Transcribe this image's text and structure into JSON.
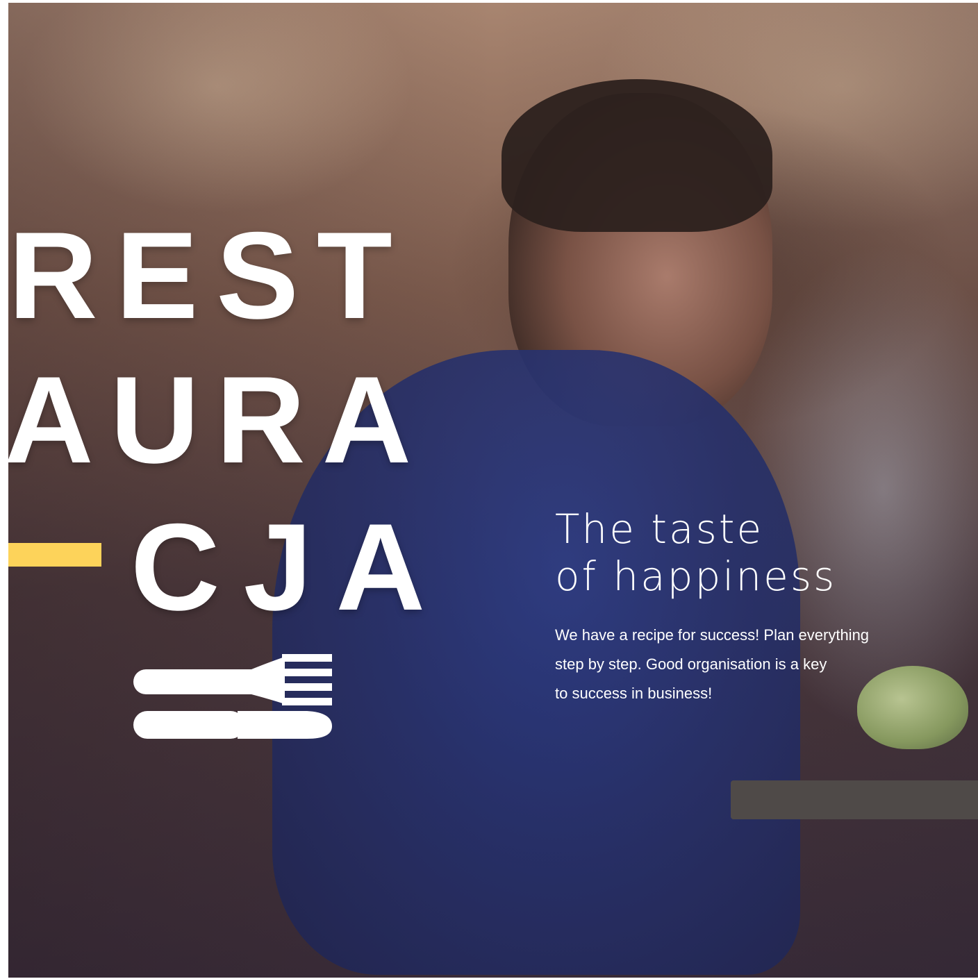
{
  "brand": {
    "lines": [
      "REST",
      "AURA",
      "CJA"
    ],
    "accent_color": "#fdd35a",
    "logo_icon": "fork-and-knife-icon"
  },
  "hero": {
    "tagline_lines": [
      "The taste",
      "of happiness"
    ],
    "description_lines": [
      "We have a recipe for success! Plan everything",
      "step by step. Good organisation is a key",
      "to success in business!"
    ],
    "text_color": "#ffffff"
  }
}
